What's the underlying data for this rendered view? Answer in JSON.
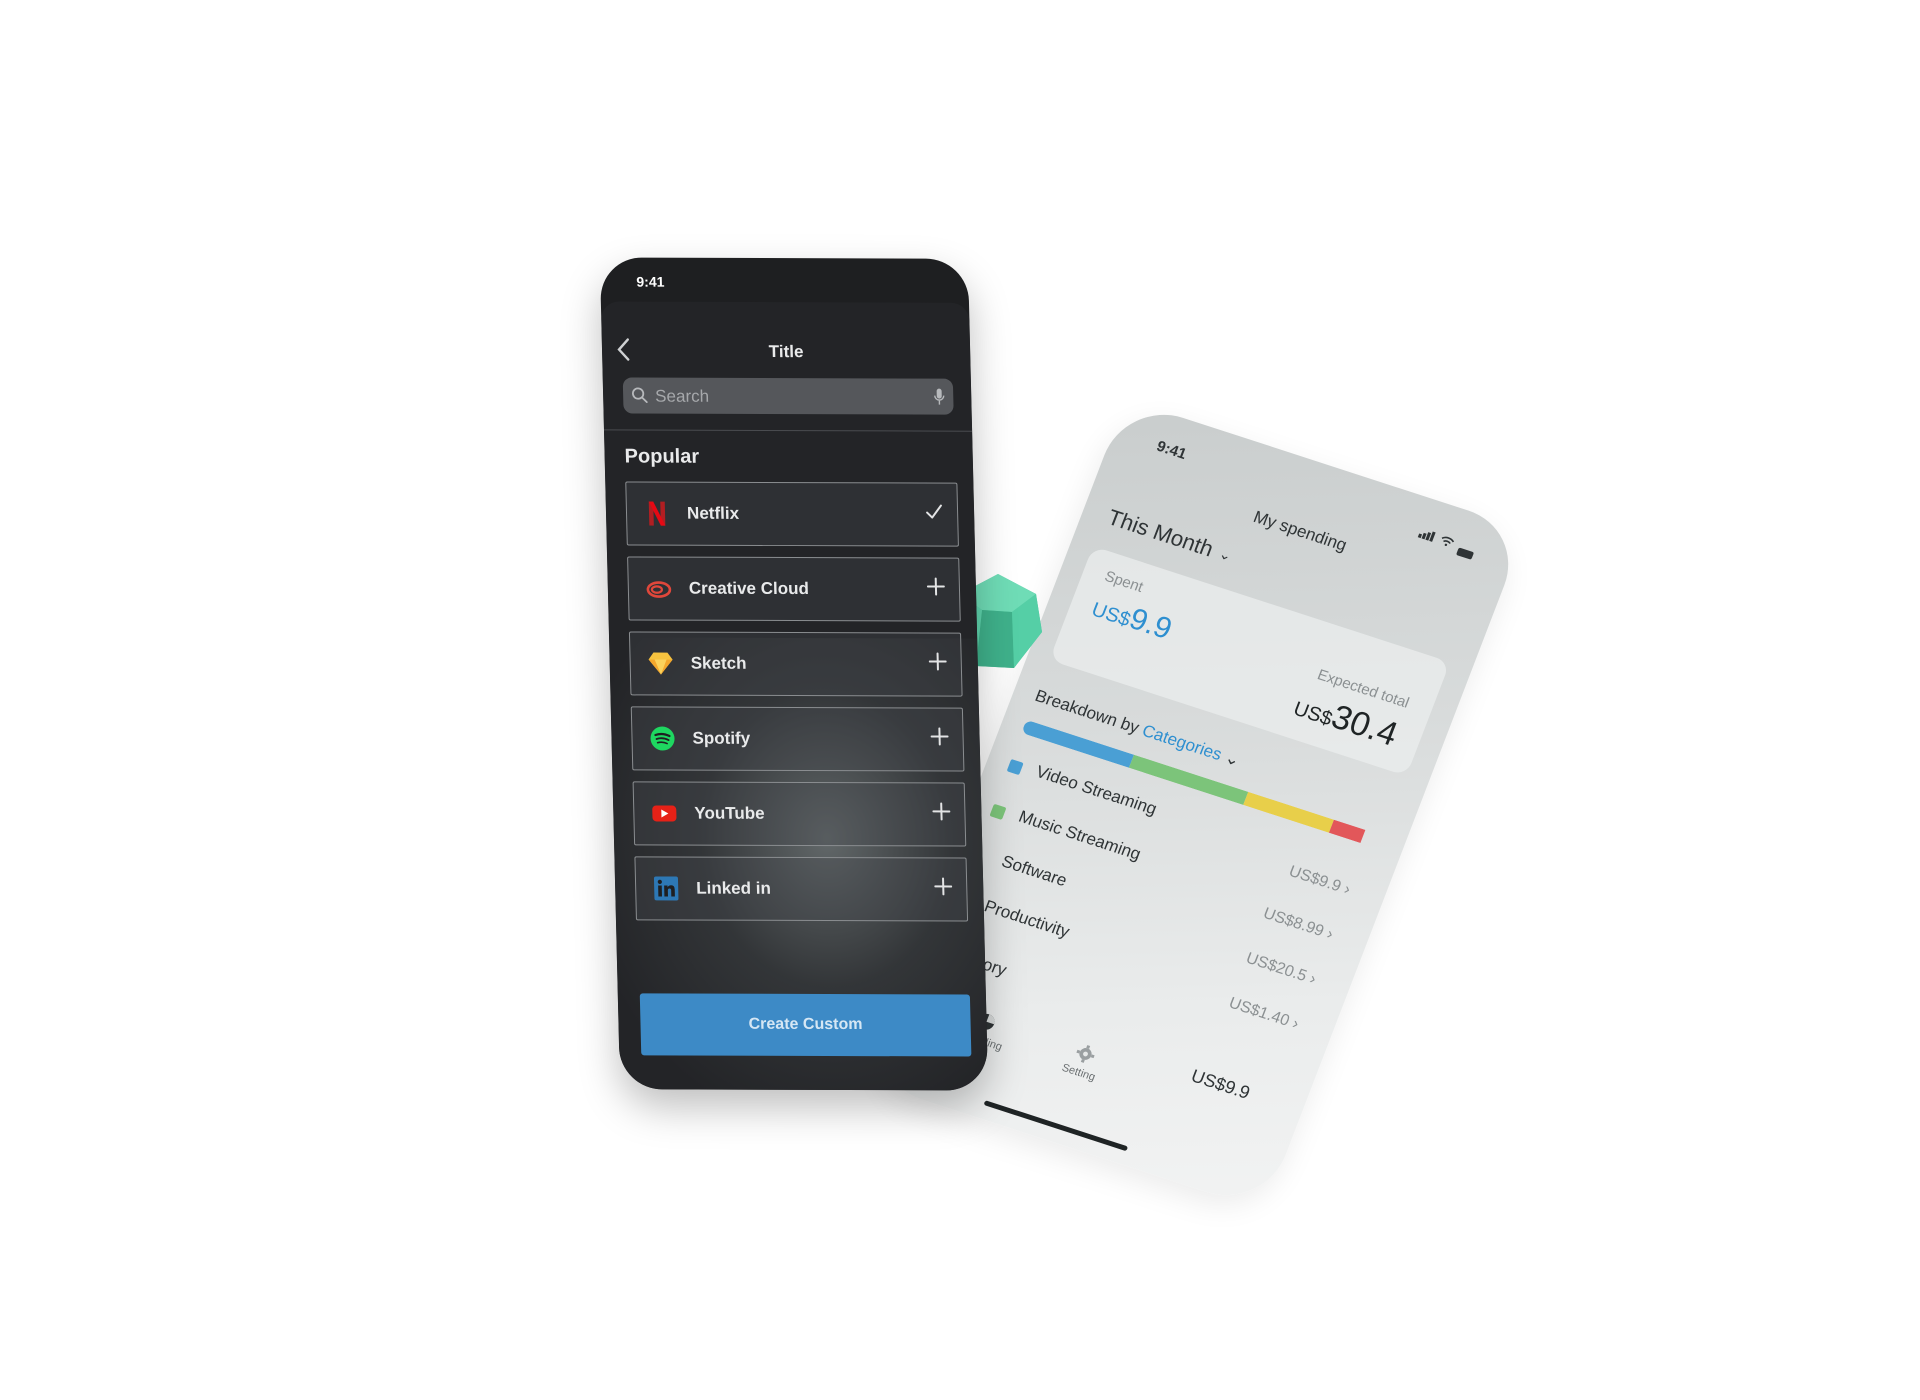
{
  "light_phone": {
    "status_time": "9:41",
    "header_title": "My spending",
    "period": "This Month",
    "spent_label": "Spent",
    "spent_currency": "US$",
    "spent_value": "9.9",
    "expected_label": "Expected total",
    "expected_currency": "US$",
    "expected_value": "30.4",
    "breakdown_prefix": "Breakdown by ",
    "breakdown_link": "Categories",
    "bar_segments": [
      {
        "color": "#4a9fd4",
        "share": 0.3
      },
      {
        "color": "#7cc47a",
        "share": 0.32
      },
      {
        "color": "#e8cf4a",
        "share": 0.24
      },
      {
        "color": "#e2575a",
        "share": 0.09
      }
    ],
    "categories": [
      {
        "name": "Video Streaming",
        "amount": "US$9.9",
        "color": "#4a9fd4"
      },
      {
        "name": "Music Streaming",
        "amount": "US$8.99",
        "color": "#7cc47a"
      },
      {
        "name": "Software",
        "amount": "US$20.5",
        "color": ""
      },
      {
        "name": "Productivity",
        "amount": "US$1.40",
        "color": ""
      }
    ],
    "history_label": "History",
    "nav": {
      "spending_label": "Spending",
      "setting_label": "Setting",
      "total": "US$9.9"
    }
  },
  "dark_phone": {
    "status_time": "9:41",
    "title": "Title",
    "search_placeholder": "Search",
    "section_title": "Popular",
    "items": [
      {
        "label": "Netflix",
        "icon": "netflix-icon",
        "state": "selected"
      },
      {
        "label": "Creative Cloud",
        "icon": "creative-cloud-icon",
        "state": "add"
      },
      {
        "label": "Sketch",
        "icon": "sketch-icon",
        "state": "add"
      },
      {
        "label": "Spotify",
        "icon": "spotify-icon",
        "state": "add"
      },
      {
        "label": "YouTube",
        "icon": "youtube-icon",
        "state": "add"
      },
      {
        "label": "Linked in",
        "icon": "linkedin-icon",
        "state": "add"
      }
    ],
    "cta_label": "Create Custom",
    "accent_color": "#3d8ac6"
  }
}
